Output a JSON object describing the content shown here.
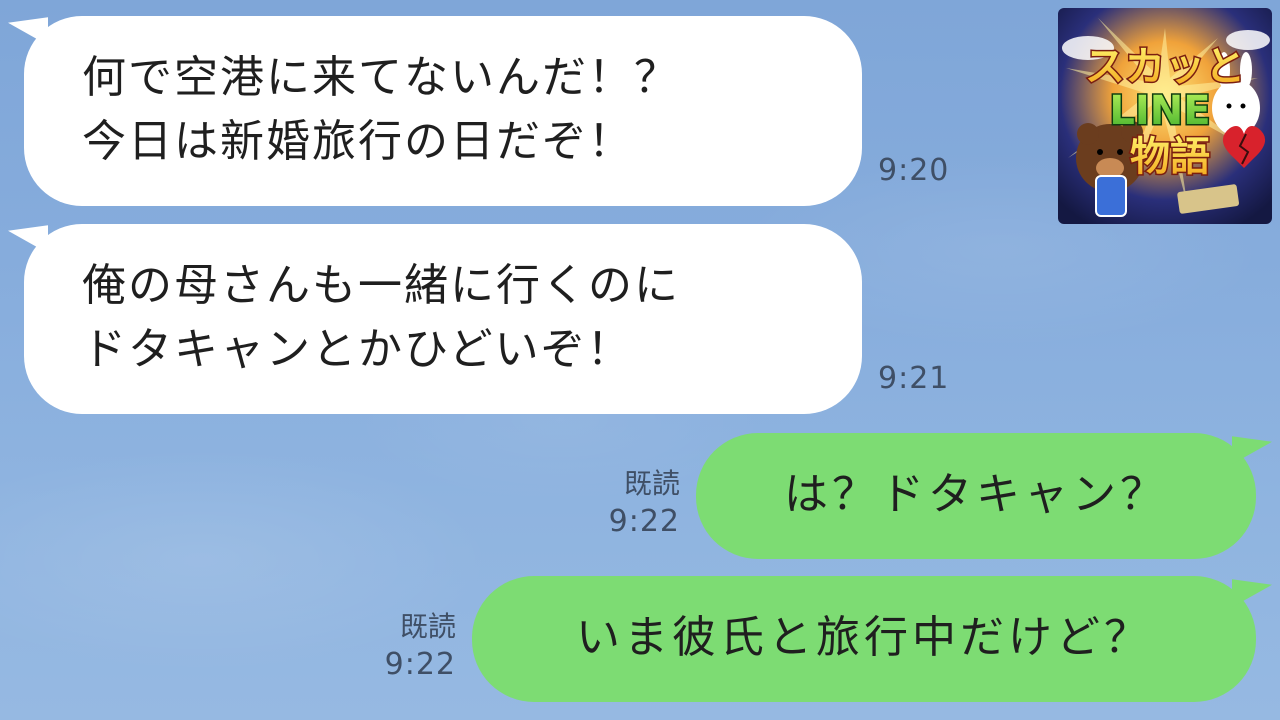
{
  "chat": {
    "messages": [
      {
        "side": "incoming",
        "lines": [
          "何で空港に来てないんだ！？",
          "今日は新婚旅行の日だぞ！"
        ],
        "time": "9:20"
      },
      {
        "side": "incoming",
        "lines": [
          "俺の母さんも一緒に行くのに",
          "ドタキャンとかひどいぞ！"
        ],
        "time": "9:21"
      },
      {
        "side": "outgoing",
        "text": "は？ドタキャン？",
        "read": "既読",
        "time": "9:22"
      },
      {
        "side": "outgoing",
        "text": "いま彼氏と旅行中だけど？",
        "read": "既読",
        "time": "9:22"
      }
    ]
  },
  "logo": {
    "line1": "スカッと",
    "line2": "LINE",
    "line3": "物語"
  },
  "colors": {
    "incoming_bubble": "#ffffff",
    "outgoing_bubble": "#7ddc73",
    "background": "#86acdc"
  }
}
